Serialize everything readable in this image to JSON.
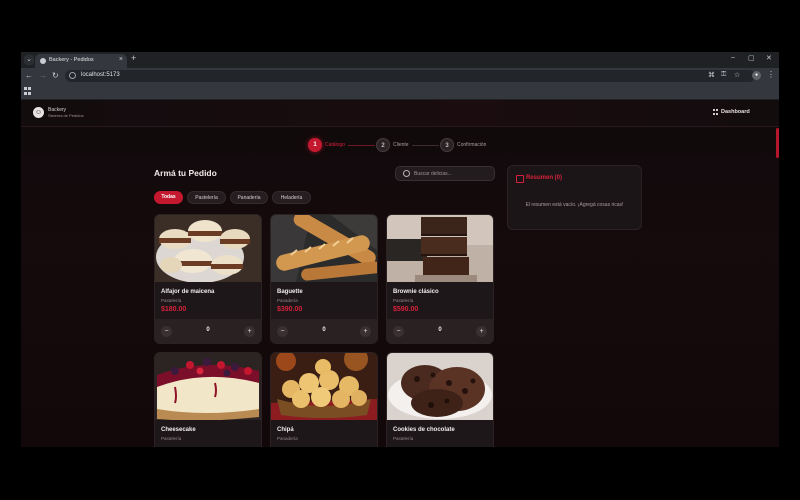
{
  "browser": {
    "tab_title": "Backery - Pedidos",
    "url": "localhost:5173",
    "new_tab": "+",
    "tab_close": "×",
    "controls": {
      "minimize": "–",
      "maximize": "▢",
      "close": "✕"
    },
    "nav": {
      "back": "←",
      "forward": "→",
      "reload": "↻",
      "menu": "⋮"
    }
  },
  "app": {
    "brand": "Backery",
    "brand_sub": "Sistema de Pedidos",
    "dashboard_label": "Dashboard"
  },
  "steps": [
    {
      "number": "1",
      "label": "Catálogo",
      "active": true
    },
    {
      "number": "2",
      "label": "Cliente",
      "active": false
    },
    {
      "number": "3",
      "label": "Confirmación",
      "active": false
    }
  ],
  "catalog": {
    "title": "Armá tu Pedido",
    "search_placeholder": "Buscar delicias...",
    "filters": [
      "Todas",
      "Pastelería",
      "Panadería",
      "Heladería"
    ],
    "active_filter": "Todas",
    "products": [
      {
        "name": "Alfajor de maicena",
        "category": "Pastelería",
        "price": "$180.00",
        "qty": "0"
      },
      {
        "name": "Baguette",
        "category": "Panadería",
        "price": "$390.00",
        "qty": "0"
      },
      {
        "name": "Brownie clásico",
        "category": "Pastelería",
        "price": "$590.00",
        "qty": "0"
      },
      {
        "name": "Cheesecake",
        "category": "Pastelería",
        "price": "",
        "qty": ""
      },
      {
        "name": "Chipá",
        "category": "Panadería",
        "price": "",
        "qty": ""
      },
      {
        "name": "Cookies de chocolate",
        "category": "Pastelería",
        "price": "",
        "qty": ""
      }
    ],
    "minus_label": "−",
    "plus_label": "+"
  },
  "summary": {
    "title": "Resumen (0)",
    "empty_text": "El resumen está vacío. ¡Agregá cosas ricas!"
  },
  "colors": {
    "accent": "#c4182f",
    "price": "#d6213a",
    "background": "#0e0a0b"
  }
}
